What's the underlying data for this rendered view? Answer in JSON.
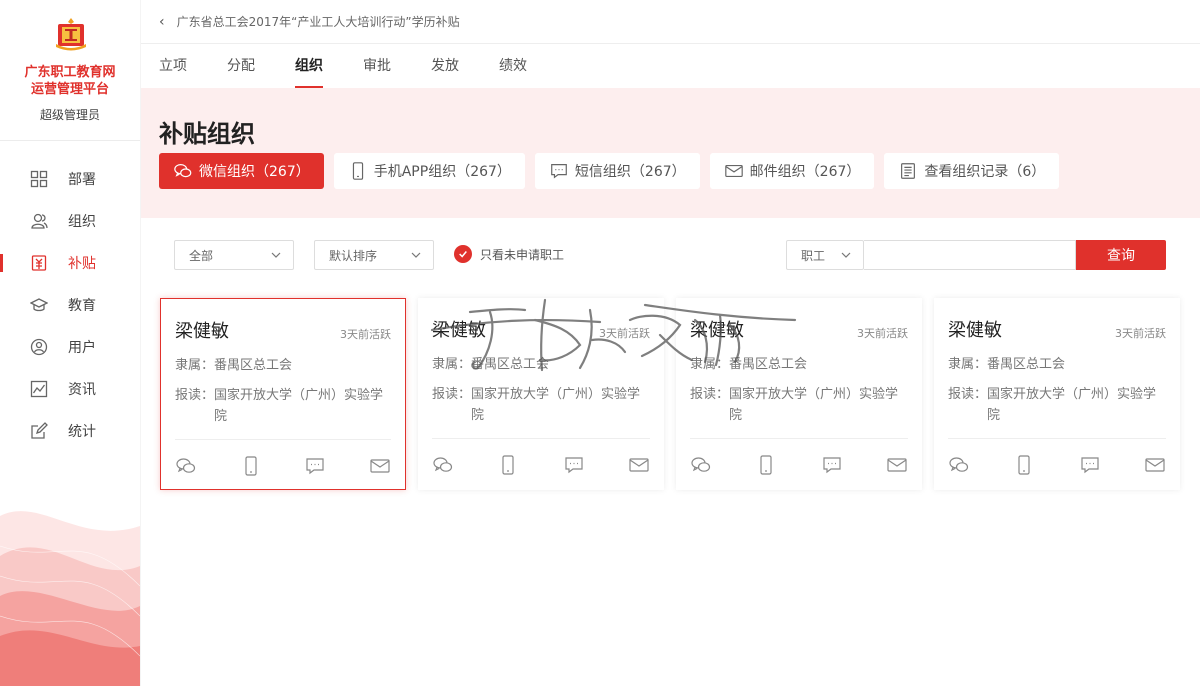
{
  "sidebar": {
    "brand_line1": "广东职工教育网",
    "brand_line2": "运营管理平台",
    "role": "超级管理员",
    "items": [
      {
        "label": "部署",
        "icon": "grid-icon"
      },
      {
        "label": "组织",
        "icon": "users-icon"
      },
      {
        "label": "补贴",
        "icon": "subsidy-icon"
      },
      {
        "label": "教育",
        "icon": "graduation-cap-icon"
      },
      {
        "label": "用户",
        "icon": "user-circle-icon"
      },
      {
        "label": "资讯",
        "icon": "chart-line-icon"
      },
      {
        "label": "统计",
        "icon": "edit-icon"
      }
    ],
    "active_index": 2
  },
  "breadcrumb": {
    "title": "广东省总工会2017年“产业工人大培训行动”学历补贴"
  },
  "tabs": [
    "立项",
    "分配",
    "组织",
    "审批",
    "发放",
    "绩效"
  ],
  "active_tab": 2,
  "hero": {
    "title": "补贴组织"
  },
  "subtabs": [
    {
      "label": "微信组织（267）",
      "icon": "wechat-icon"
    },
    {
      "label": "手机APP组织（267）",
      "icon": "phone-icon"
    },
    {
      "label": "短信组织（267）",
      "icon": "sms-icon"
    },
    {
      "label": "邮件组织（267）",
      "icon": "mail-icon"
    },
    {
      "label": "查看组织记录（6）",
      "icon": "document-icon"
    }
  ],
  "filters": {
    "scope": "全部",
    "sort": "默认排序",
    "only_unapplied": "只看未申请职工",
    "search_type": "职工",
    "search_placeholder": "",
    "search_button": "查询"
  },
  "cards": [
    {
      "name": "梁健敏",
      "active": "3天前活跃",
      "affiliation_key": "隶属：",
      "affiliation": "番禺区总工会",
      "school_key": "报读：",
      "school": "国家开放大学（广州）实验学院"
    },
    {
      "name": "梁健敏",
      "active": "3天前活跃",
      "affiliation_key": "隶属：",
      "affiliation": "番禺区总工会",
      "school_key": "报读：",
      "school": "国家开放大学（广州）实验学院"
    },
    {
      "name": "梁健敏",
      "active": "3天前活跃",
      "affiliation_key": "隶属：",
      "affiliation": "番禺区总工会",
      "school_key": "报读：",
      "school": "国家开放大学（广州）实验学院"
    },
    {
      "name": "梁健敏",
      "active": "3天前活跃",
      "affiliation_key": "隶属：",
      "affiliation": "番禺区总工会",
      "school_key": "报读：",
      "school": "国家开放大学（广州）实验学院"
    }
  ],
  "colors": {
    "accent": "#e0312c",
    "hero_bg": "#fdeeee"
  }
}
